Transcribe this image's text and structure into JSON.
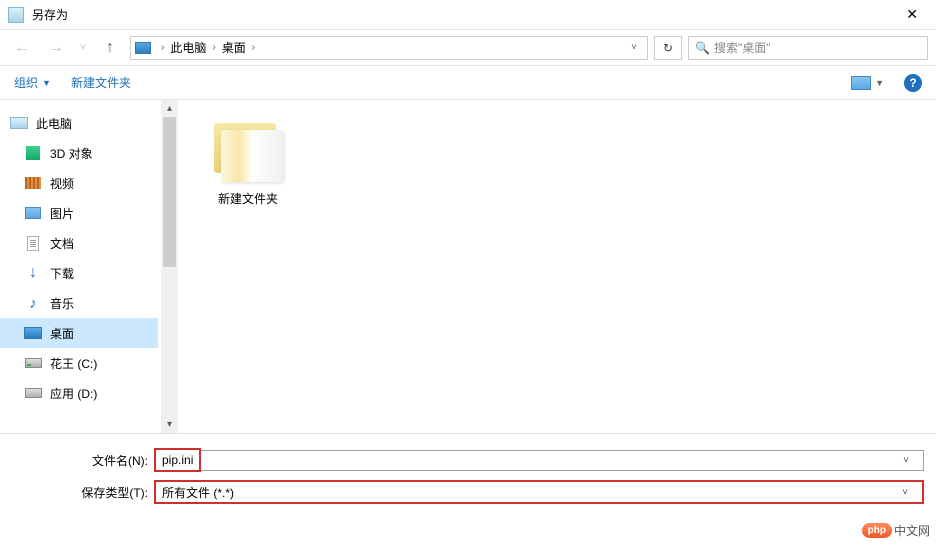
{
  "titlebar": {
    "title": "另存为"
  },
  "breadcrumb": {
    "items": [
      "此电脑",
      "桌面"
    ]
  },
  "search": {
    "placeholder": "搜索\"桌面\""
  },
  "toolbar": {
    "organize": "组织",
    "newfolder": "新建文件夹"
  },
  "sidebar": {
    "items": [
      {
        "label": "此电脑"
      },
      {
        "label": "3D 对象"
      },
      {
        "label": "视频"
      },
      {
        "label": "图片"
      },
      {
        "label": "文档"
      },
      {
        "label": "下载"
      },
      {
        "label": "音乐"
      },
      {
        "label": "桌面"
      },
      {
        "label": "花王 (C:)"
      },
      {
        "label": "应用 (D:)"
      }
    ]
  },
  "content": {
    "folder_name": "新建文件夹"
  },
  "fields": {
    "filename_label": "文件名(N):",
    "filename_value": "pip.ini",
    "filetype_label": "保存类型(T):",
    "filetype_value": "所有文件 (*.*)"
  },
  "watermark": {
    "badge": "php",
    "text": "中文网"
  }
}
